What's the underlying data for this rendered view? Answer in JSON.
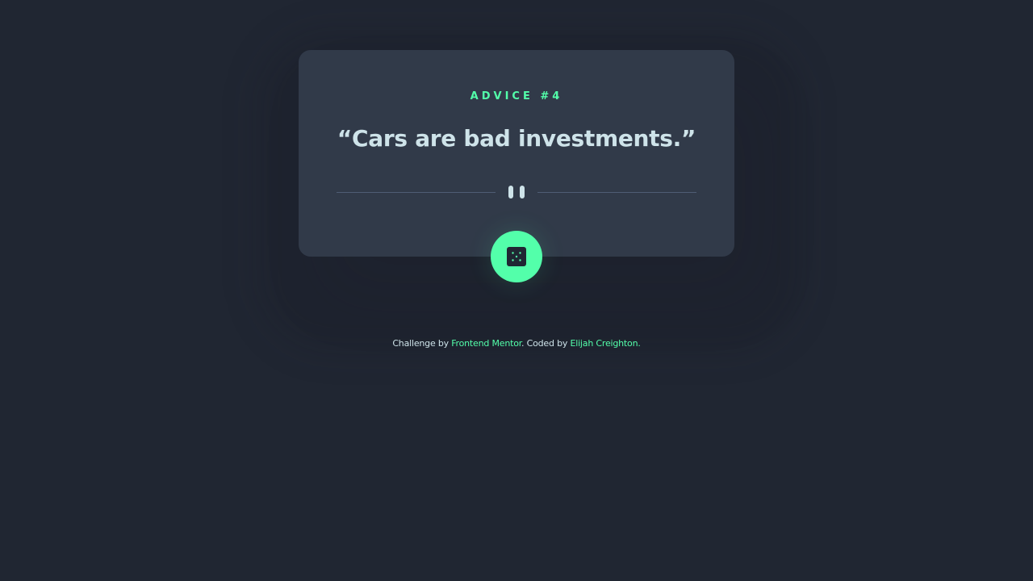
{
  "advice": {
    "number_label": "ADVICE #4",
    "quote": "“Cars are bad investments.”"
  },
  "icons": {
    "divider_icon": "pause-icon",
    "button_icon": "dice-icon"
  },
  "footer": {
    "challenge_prefix": "Challenge by ",
    "challenge_link": "Frontend Mentor",
    "coded_prefix": ". Coded by ",
    "author_link": "Elijah Creighton",
    "suffix": "."
  },
  "colors": {
    "background": "#202632",
    "card": "#313a49",
    "accent": "#53ffaa",
    "text": "#cee3e9",
    "divider": "#4f5d74"
  }
}
